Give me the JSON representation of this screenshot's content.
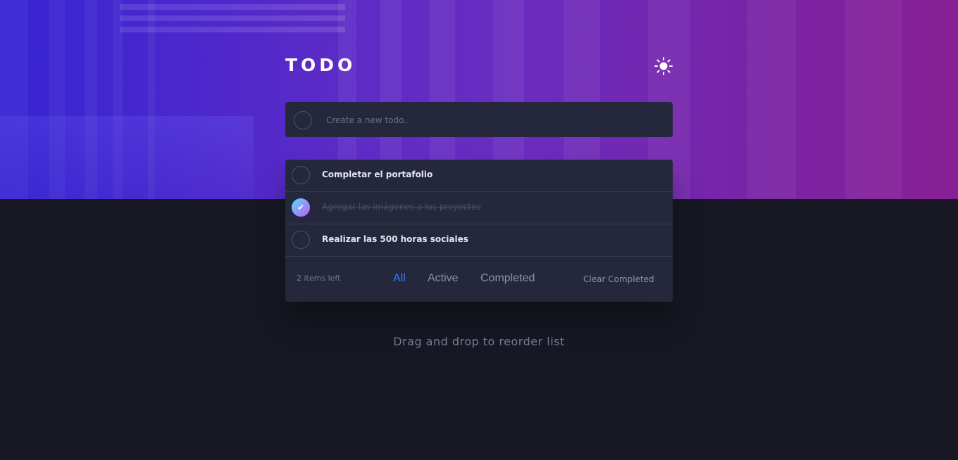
{
  "header": {
    "title": "TODO",
    "theme_icon": "sun-icon"
  },
  "new_todo": {
    "placeholder": "Create a new todo..",
    "value": ""
  },
  "todos": [
    {
      "text": "Completar el portafolio",
      "completed": false
    },
    {
      "text": "Agregar las imágenes a los proyectos",
      "completed": true
    },
    {
      "text": "Realizar las 500 horas sociales",
      "completed": false
    }
  ],
  "footer": {
    "items_left": "2 items left",
    "filters": [
      "All",
      "Active",
      "Completed"
    ],
    "active_filter": "All",
    "clear_label": "Clear Completed"
  },
  "hint": "Drag and drop to reorder list",
  "colors": {
    "accent": "#3a7bfd",
    "check_gradient_start": "#57ddff",
    "check_gradient_end": "#c058f3",
    "panel": "#25273c",
    "background": "#181824"
  }
}
